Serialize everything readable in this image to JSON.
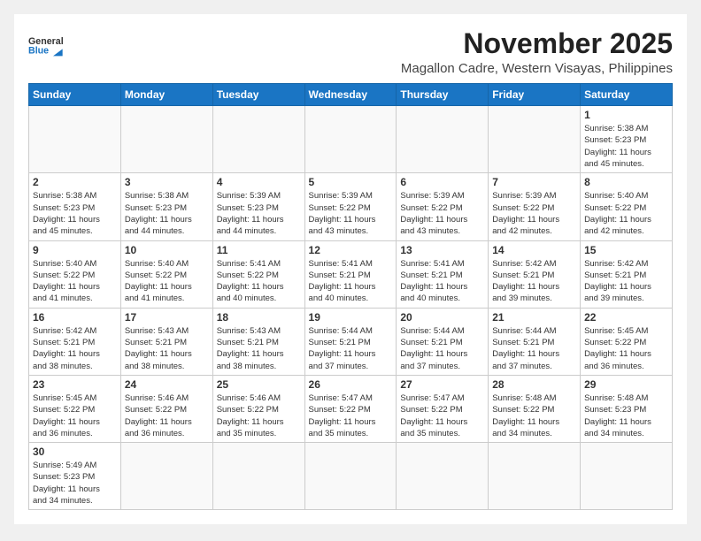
{
  "header": {
    "logo_general": "General",
    "logo_blue": "Blue",
    "month": "November 2025",
    "location": "Magallon Cadre, Western Visayas, Philippines"
  },
  "weekdays": [
    "Sunday",
    "Monday",
    "Tuesday",
    "Wednesday",
    "Thursday",
    "Friday",
    "Saturday"
  ],
  "days": [
    {
      "date": "",
      "info": ""
    },
    {
      "date": "",
      "info": ""
    },
    {
      "date": "",
      "info": ""
    },
    {
      "date": "",
      "info": ""
    },
    {
      "date": "",
      "info": ""
    },
    {
      "date": "",
      "info": ""
    },
    {
      "date": "1",
      "sunrise": "5:38 AM",
      "sunset": "5:23 PM",
      "hours": "11",
      "minutes": "45"
    },
    {
      "date": "2",
      "sunrise": "5:38 AM",
      "sunset": "5:23 PM",
      "hours": "11",
      "minutes": "45"
    },
    {
      "date": "3",
      "sunrise": "5:38 AM",
      "sunset": "5:23 PM",
      "hours": "11",
      "minutes": "44"
    },
    {
      "date": "4",
      "sunrise": "5:39 AM",
      "sunset": "5:23 PM",
      "hours": "11",
      "minutes": "44"
    },
    {
      "date": "5",
      "sunrise": "5:39 AM",
      "sunset": "5:22 PM",
      "hours": "11",
      "minutes": "43"
    },
    {
      "date": "6",
      "sunrise": "5:39 AM",
      "sunset": "5:22 PM",
      "hours": "11",
      "minutes": "43"
    },
    {
      "date": "7",
      "sunrise": "5:39 AM",
      "sunset": "5:22 PM",
      "hours": "11",
      "minutes": "42"
    },
    {
      "date": "8",
      "sunrise": "5:40 AM",
      "sunset": "5:22 PM",
      "hours": "11",
      "minutes": "42"
    },
    {
      "date": "9",
      "sunrise": "5:40 AM",
      "sunset": "5:22 PM",
      "hours": "11",
      "minutes": "41"
    },
    {
      "date": "10",
      "sunrise": "5:40 AM",
      "sunset": "5:22 PM",
      "hours": "11",
      "minutes": "41"
    },
    {
      "date": "11",
      "sunrise": "5:41 AM",
      "sunset": "5:22 PM",
      "hours": "11",
      "minutes": "40"
    },
    {
      "date": "12",
      "sunrise": "5:41 AM",
      "sunset": "5:21 PM",
      "hours": "11",
      "minutes": "40"
    },
    {
      "date": "13",
      "sunrise": "5:41 AM",
      "sunset": "5:21 PM",
      "hours": "11",
      "minutes": "40"
    },
    {
      "date": "14",
      "sunrise": "5:42 AM",
      "sunset": "5:21 PM",
      "hours": "11",
      "minutes": "39"
    },
    {
      "date": "15",
      "sunrise": "5:42 AM",
      "sunset": "5:21 PM",
      "hours": "11",
      "minutes": "39"
    },
    {
      "date": "16",
      "sunrise": "5:42 AM",
      "sunset": "5:21 PM",
      "hours": "11",
      "minutes": "38"
    },
    {
      "date": "17",
      "sunrise": "5:43 AM",
      "sunset": "5:21 PM",
      "hours": "11",
      "minutes": "38"
    },
    {
      "date": "18",
      "sunrise": "5:43 AM",
      "sunset": "5:21 PM",
      "hours": "11",
      "minutes": "38"
    },
    {
      "date": "19",
      "sunrise": "5:44 AM",
      "sunset": "5:21 PM",
      "hours": "11",
      "minutes": "37"
    },
    {
      "date": "20",
      "sunrise": "5:44 AM",
      "sunset": "5:21 PM",
      "hours": "11",
      "minutes": "37"
    },
    {
      "date": "21",
      "sunrise": "5:44 AM",
      "sunset": "5:21 PM",
      "hours": "11",
      "minutes": "37"
    },
    {
      "date": "22",
      "sunrise": "5:45 AM",
      "sunset": "5:22 PM",
      "hours": "11",
      "minutes": "36"
    },
    {
      "date": "23",
      "sunrise": "5:45 AM",
      "sunset": "5:22 PM",
      "hours": "11",
      "minutes": "36"
    },
    {
      "date": "24",
      "sunrise": "5:46 AM",
      "sunset": "5:22 PM",
      "hours": "11",
      "minutes": "36"
    },
    {
      "date": "25",
      "sunrise": "5:46 AM",
      "sunset": "5:22 PM",
      "hours": "11",
      "minutes": "35"
    },
    {
      "date": "26",
      "sunrise": "5:47 AM",
      "sunset": "5:22 PM",
      "hours": "11",
      "minutes": "35"
    },
    {
      "date": "27",
      "sunrise": "5:47 AM",
      "sunset": "5:22 PM",
      "hours": "11",
      "minutes": "35"
    },
    {
      "date": "28",
      "sunrise": "5:48 AM",
      "sunset": "5:22 PM",
      "hours": "11",
      "minutes": "34"
    },
    {
      "date": "29",
      "sunrise": "5:48 AM",
      "sunset": "5:23 PM",
      "hours": "11",
      "minutes": "34"
    },
    {
      "date": "30",
      "sunrise": "5:49 AM",
      "sunset": "5:23 PM",
      "hours": "11",
      "minutes": "34"
    }
  ],
  "labels": {
    "sunrise": "Sunrise:",
    "sunset": "Sunset:",
    "daylight": "Daylight:",
    "hours_suffix": "hours",
    "and": "and",
    "minutes_suffix": "minutes."
  }
}
